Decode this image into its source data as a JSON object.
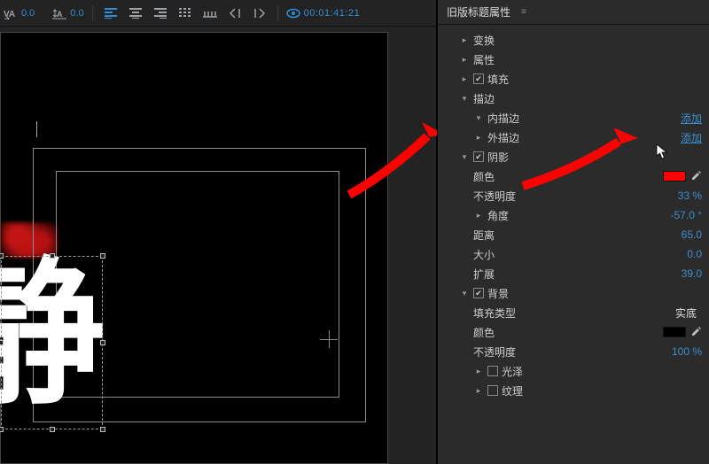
{
  "toolbar": {
    "tracking_value": "0.0",
    "baseline_value": "0.0",
    "timecode": "00:01:41:21"
  },
  "canvas": {
    "glyph_text": "静"
  },
  "panel": {
    "title": "旧版标题属性",
    "transform_label": "变换",
    "props_label": "属性",
    "fill_label": "填充",
    "stroke": {
      "label": "描边",
      "inner_label": "内描边",
      "inner_action": "添加",
      "outer_label": "外描边",
      "outer_action": "添加"
    },
    "shadow": {
      "label": "阴影",
      "color_label": "颜色",
      "color_value": "#ff0000",
      "opacity_label": "不透明度",
      "opacity_value": "33 %",
      "angle_label": "角度",
      "angle_value": "-57.0 °",
      "distance_label": "距离",
      "distance_value": "65.0",
      "size_label": "大小",
      "size_value": "0.0",
      "spread_label": "扩展",
      "spread_value": "39.0"
    },
    "background": {
      "label": "背景",
      "fill_type_label": "填充类型",
      "fill_type_value": "实底",
      "color_label": "颜色",
      "color_value": "#000000",
      "opacity_label": "不透明度",
      "opacity_value": "100 %",
      "sheen_label": "光泽",
      "texture_label": "纹理"
    }
  }
}
